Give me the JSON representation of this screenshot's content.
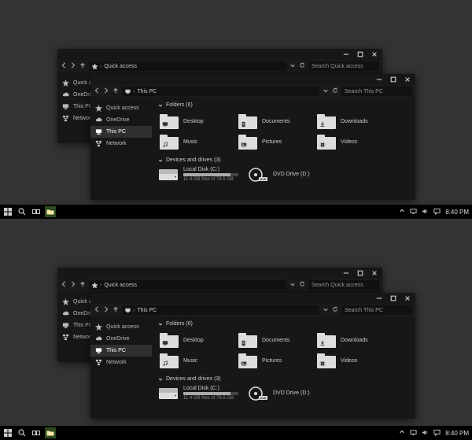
{
  "taskbar": {
    "clock": "8:40 PM"
  },
  "back_window": {
    "title_path": "Quick access",
    "search_placeholder": "Search Quick access",
    "sidebar": [
      {
        "label": "Quick access",
        "key": "quick"
      },
      {
        "label": "OneDrive",
        "key": "onedrive"
      },
      {
        "label": "This PC",
        "key": "thispc"
      },
      {
        "label": "Network",
        "key": "network"
      }
    ]
  },
  "front_window": {
    "title_path": "This PC",
    "search_placeholder": "Search This PC",
    "sidebar": [
      {
        "label": "Quick access",
        "key": "quick"
      },
      {
        "label": "OneDrive",
        "key": "onedrive"
      },
      {
        "label": "This PC",
        "key": "thispc"
      },
      {
        "label": "Network",
        "key": "network"
      }
    ],
    "sidebar_selected": "thispc",
    "sections": {
      "folders": {
        "header": "Folders (6)",
        "items": [
          {
            "label": "Desktop"
          },
          {
            "label": "Documents"
          },
          {
            "label": "Downloads"
          },
          {
            "label": "Music"
          },
          {
            "label": "Pictures"
          },
          {
            "label": "Videos"
          }
        ]
      },
      "devices": {
        "header": "Devices and drives (3)",
        "items": [
          {
            "kind": "disk",
            "label": "Local Disk (C:)",
            "free_text": "11.4 GB free of 78.5 GB",
            "used_percent": 85
          },
          {
            "kind": "dvd",
            "label": "DVD Drive (D:)"
          }
        ]
      }
    }
  }
}
